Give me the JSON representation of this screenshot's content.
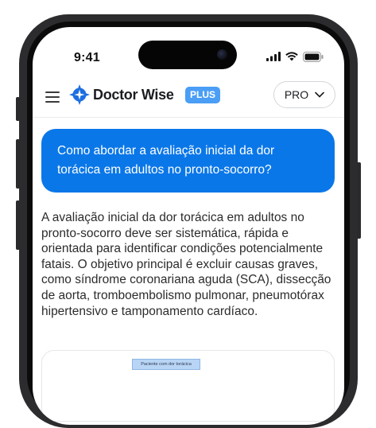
{
  "status_bar": {
    "time": "9:41"
  },
  "header": {
    "brand_name": "Doctor Wise",
    "brand_badge": "PLUS",
    "plan_selector": "PRO"
  },
  "chat": {
    "question": "Como abordar a avaliação inicial da dor torácica em adultos no pronto-socorro?",
    "answer": "A avaliação inicial da dor torácica em adultos no pronto-socorro deve ser sistemática, rápida e orientada para identificar condições potencialmente fatais. O objetivo principal é excluir causas graves, como síndrome coronariana aguda (SCA), dissecção de aorta, tromboembolismo pulmonar, pneumotórax hipertensivo e tamponamento cardíaco.",
    "flowchart": {
      "first_node": "Paciente com dor torácica"
    }
  },
  "colors": {
    "accent": "#0a77e8",
    "badge": "#4a9ef5",
    "logo": "#1d6fe0"
  }
}
